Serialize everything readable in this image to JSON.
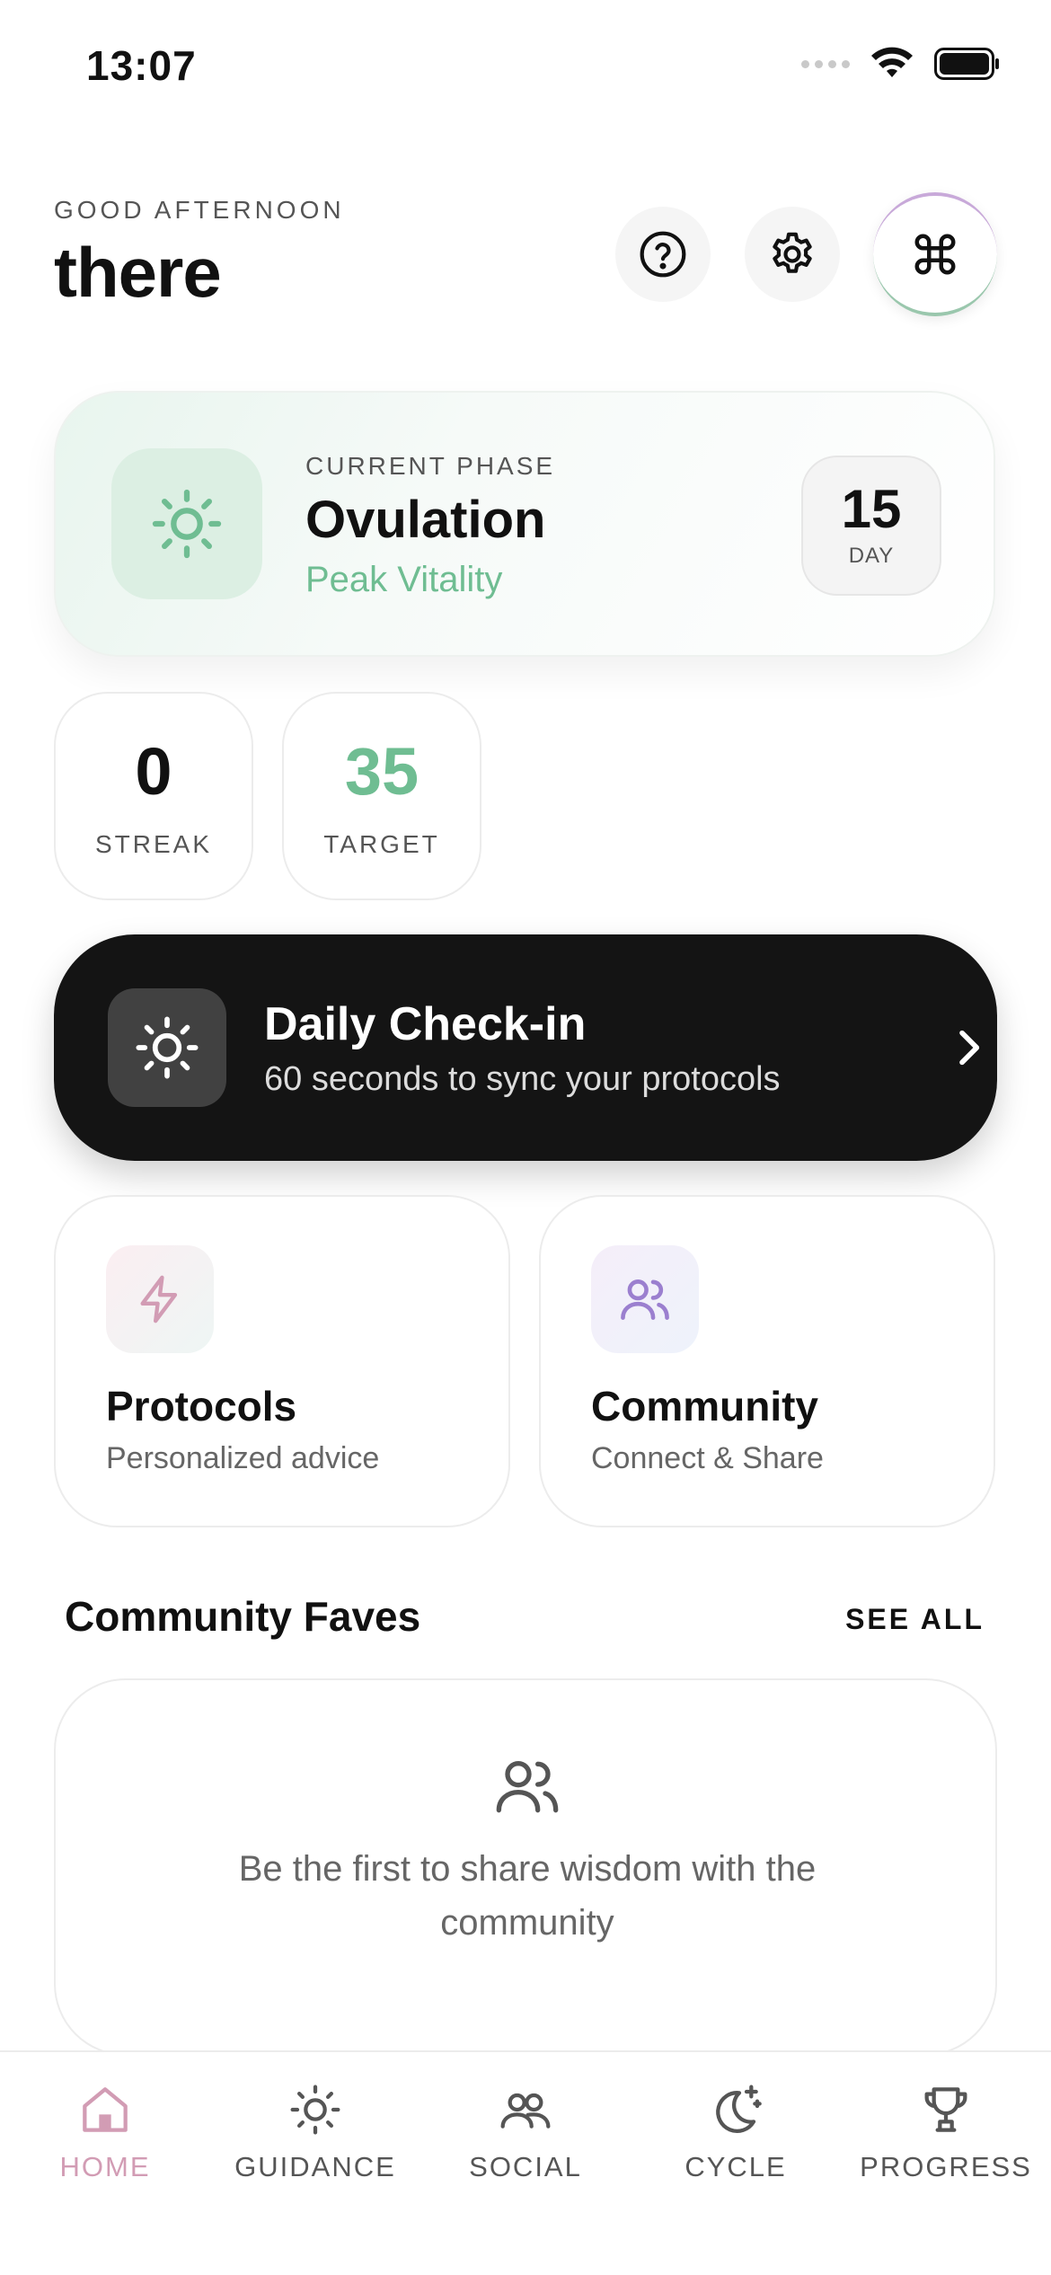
{
  "status_bar": {
    "time": "13:07"
  },
  "header": {
    "greeting": "GOOD AFTERNOON",
    "name": "there"
  },
  "phase": {
    "label": "CURRENT PHASE",
    "name": "Ovulation",
    "subtitle": "Peak Vitality",
    "day_number": "15",
    "day_label": "DAY"
  },
  "stats": {
    "streak_value": "0",
    "streak_label": "STREAK",
    "target_value": "35",
    "target_label": "TARGET"
  },
  "checkin": {
    "title": "Daily Check-in",
    "subtitle": "60 seconds to sync your protocols"
  },
  "features": [
    {
      "title": "Protocols",
      "subtitle": "Personalized advice"
    },
    {
      "title": "Community",
      "subtitle": "Connect & Share"
    }
  ],
  "community_faves": {
    "title": "Community Faves",
    "see_all": "SEE ALL",
    "empty_text": "Be the first to share wisdom with the community"
  },
  "tabs": [
    {
      "label": "HOME",
      "icon": "home-icon",
      "active": true
    },
    {
      "label": "GUIDANCE",
      "icon": "sun-icon",
      "active": false
    },
    {
      "label": "SOCIAL",
      "icon": "users-icon",
      "active": false
    },
    {
      "label": "CYCLE",
      "icon": "moon-icon",
      "active": false
    },
    {
      "label": "PROGRESS",
      "icon": "trophy-icon",
      "active": false
    }
  ],
  "colors": {
    "accent_green": "#6fbd92",
    "accent_pink": "#d29cb4",
    "accent_purple": "#9b7fcf",
    "dark_card": "#141414"
  }
}
